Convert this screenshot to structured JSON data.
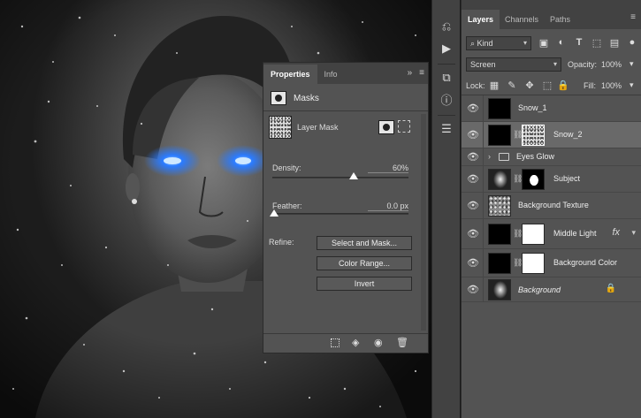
{
  "properties": {
    "tabs": [
      "Properties",
      "Info"
    ],
    "active_tab": "Properties",
    "section_title": "Masks",
    "layer_mask_label": "Layer Mask",
    "density_label": "Density:",
    "density_value": "60%",
    "density_fraction": 0.6,
    "feather_label": "Feather:",
    "feather_value": "0.0 px",
    "feather_fraction": 0.0,
    "refine_label": "Refine:",
    "buttons": [
      "Select and Mask...",
      "Color Range...",
      "Invert"
    ],
    "footer_icons": [
      "selection-from-mask-icon",
      "apply-mask-icon",
      "eye-icon",
      "trash-icon"
    ]
  },
  "toolstrip": {
    "icons": [
      "history-icon",
      "play-icon",
      "3d-icon",
      "info-icon",
      "brush-presets-icon"
    ]
  },
  "layers_panel": {
    "tabs": [
      "Layers",
      "Channels",
      "Paths"
    ],
    "active_tab": "Layers",
    "filter_kind": "Kind",
    "blend_mode": "Screen",
    "opacity_label": "Opacity:",
    "opacity_value": "100%",
    "lock_label": "Lock:",
    "fill_label": "Fill:",
    "fill_value": "100%",
    "layers": [
      {
        "name": "Snow_1",
        "thumb": "black",
        "mask": null,
        "selected": false
      },
      {
        "name": "Snow_2",
        "thumb": "black",
        "mask": "noise",
        "selected": true
      },
      {
        "name": "Eyes Glow",
        "thumb": "folder",
        "mask": null,
        "selected": false
      },
      {
        "name": "Subject",
        "thumb": "face",
        "mask": "subjmask",
        "selected": false
      },
      {
        "name": "Background Texture",
        "thumb": "tex",
        "mask": null,
        "selected": false
      },
      {
        "name": "Middle Light",
        "thumb": "black",
        "mask": "white",
        "selected": false,
        "fx": "fx"
      },
      {
        "name": "Background Color",
        "thumb": "black",
        "mask": "white",
        "selected": false
      },
      {
        "name": "Background",
        "thumb": "face",
        "mask": null,
        "selected": false,
        "locked": true
      }
    ]
  },
  "colors": {
    "panel": "#535353",
    "panel_dark": "#424242",
    "selected_row": "#696969",
    "eye_glow": "#2b7bff"
  }
}
